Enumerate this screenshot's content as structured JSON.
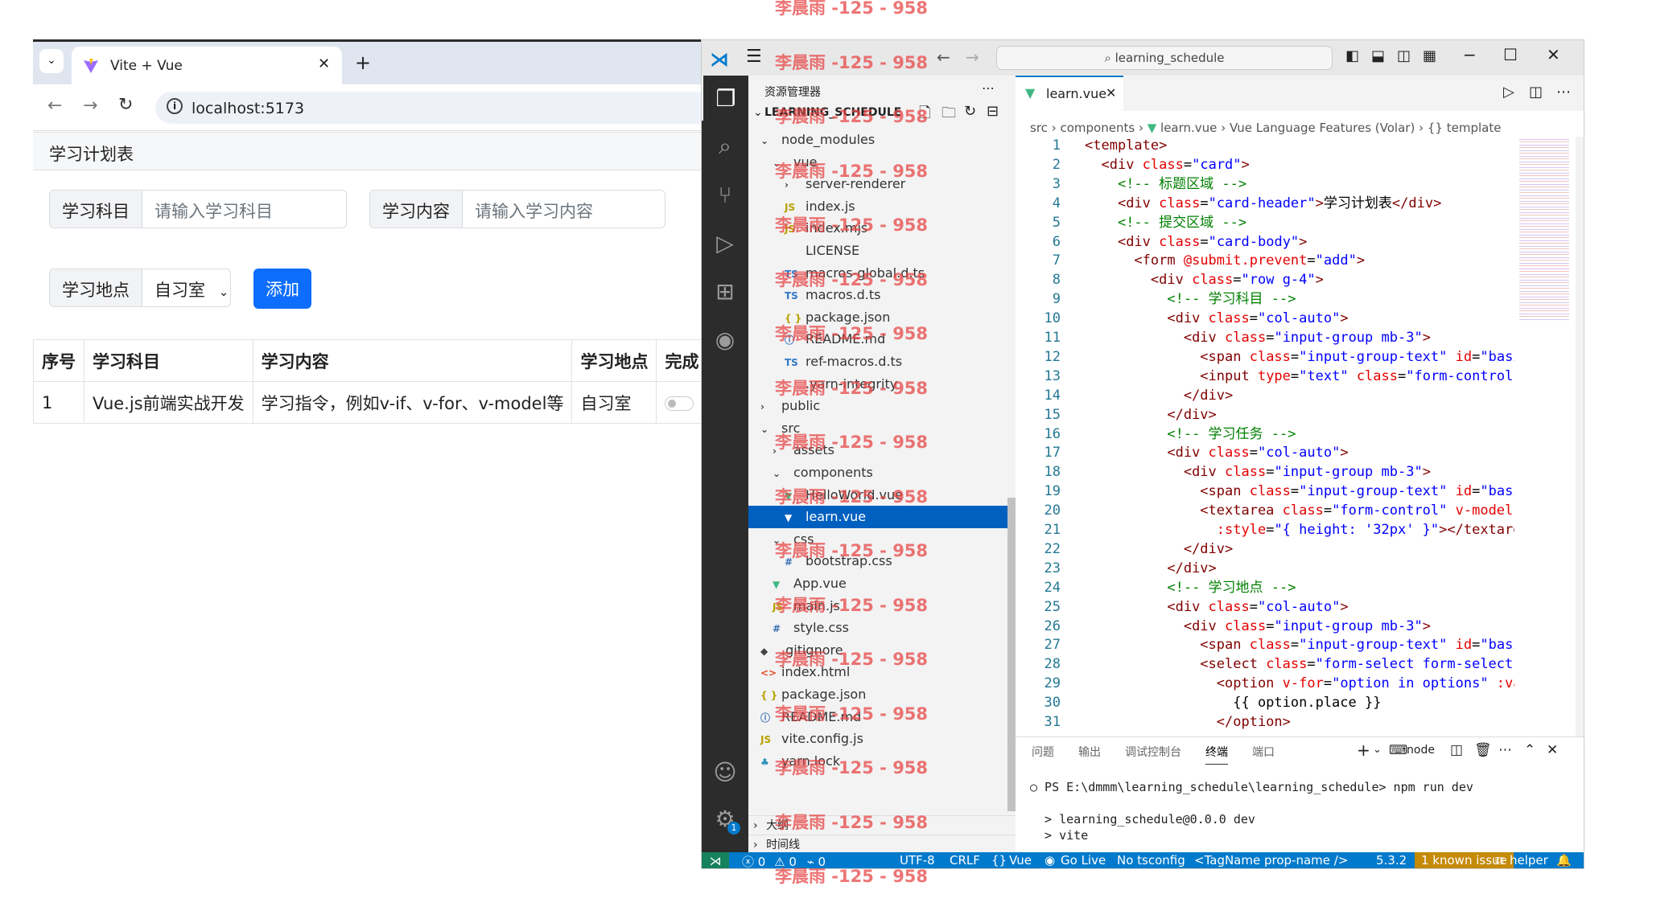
{
  "browser": {
    "tab_title": "Vite + Vue",
    "url": "localhost:5173",
    "page": {
      "header": "学习计划表",
      "subject_label": "学习科目",
      "subject_placeholder": "请输入学习科目",
      "content_label": "学习内容",
      "content_placeholder": "请输入学习内容",
      "place_label": "学习地点",
      "place_value": "自习室",
      "add_button": "添加",
      "table_headers": [
        "序号",
        "学习科目",
        "学习内容",
        "学习地点",
        "完成"
      ],
      "rows": [
        {
          "index": "1",
          "subject": "Vue.js前端实战开发",
          "content": "学习指令，例如v-if、v-for、v-model等",
          "place": "自习室",
          "done": false
        }
      ]
    }
  },
  "vscode": {
    "search_text": "learning_schedule",
    "explorer_title": "资源管理器",
    "project_title": "LEARNING_SCHEDULE",
    "tree": [
      {
        "label": "node_modules",
        "indent": 1,
        "icon": "chevron-down",
        "selected": false
      },
      {
        "label": "vue",
        "indent": 2,
        "icon": "chevron-down",
        "selected": false
      },
      {
        "label": "server-renderer",
        "indent": 3,
        "icon": "chevron-right",
        "selected": false
      },
      {
        "label": "index.js",
        "indent": 3,
        "icon": "js",
        "selected": false
      },
      {
        "label": "index.mjs",
        "indent": 3,
        "icon": "js",
        "selected": false
      },
      {
        "label": "LICENSE",
        "indent": 3,
        "icon": "none",
        "selected": false
      },
      {
        "label": "macros-global.d.ts",
        "indent": 3,
        "icon": "ts",
        "selected": false
      },
      {
        "label": "macros.d.ts",
        "indent": 3,
        "icon": "ts",
        "selected": false
      },
      {
        "label": "package.json",
        "indent": 3,
        "icon": "json",
        "selected": false
      },
      {
        "label": "README.md",
        "indent": 3,
        "icon": "info",
        "selected": false
      },
      {
        "label": "ref-macros.d.ts",
        "indent": 3,
        "icon": "ts",
        "selected": false
      },
      {
        "label": ".yarn-integrity",
        "indent": 3,
        "icon": "none",
        "selected": false
      },
      {
        "label": "public",
        "indent": 1,
        "icon": "chevron-right",
        "selected": false
      },
      {
        "label": "src",
        "indent": 1,
        "icon": "chevron-down",
        "selected": false
      },
      {
        "label": "assets",
        "indent": 2,
        "icon": "chevron-right",
        "selected": false
      },
      {
        "label": "components",
        "indent": 2,
        "icon": "chevron-down",
        "selected": false
      },
      {
        "label": "HelloWorld.vue",
        "indent": 3,
        "icon": "vue",
        "selected": false
      },
      {
        "label": "learn.vue",
        "indent": 3,
        "icon": "vue",
        "selected": true
      },
      {
        "label": "css",
        "indent": 2,
        "icon": "chevron-down",
        "selected": false
      },
      {
        "label": "bootstrap.css",
        "indent": 3,
        "icon": "hash",
        "selected": false
      },
      {
        "label": "App.vue",
        "indent": 2,
        "icon": "vue",
        "selected": false
      },
      {
        "label": "main.js",
        "indent": 2,
        "icon": "js",
        "selected": false
      },
      {
        "label": "style.css",
        "indent": 2,
        "icon": "hash",
        "selected": false
      },
      {
        "label": ".gitignore",
        "indent": 1,
        "icon": "diamond",
        "selected": false
      },
      {
        "label": "index.html",
        "indent": 1,
        "icon": "html",
        "selected": false
      },
      {
        "label": "package.json",
        "indent": 1,
        "icon": "json",
        "selected": false
      },
      {
        "label": "README.md",
        "indent": 1,
        "icon": "info",
        "selected": false
      },
      {
        "label": "vite.config.js",
        "indent": 1,
        "icon": "js",
        "selected": false
      },
      {
        "label": "yarn.lock",
        "indent": 1,
        "icon": "yarn",
        "selected": false
      }
    ],
    "outline_label": "大纲",
    "timeline_label": "时间线",
    "editor_tab": "learn.vue",
    "breadcrumb": [
      "src",
      "components",
      "learn.vue",
      "Vue Language Features (Volar)",
      "template"
    ],
    "code_lines": [
      [
        [
          "tg",
          "<template>"
        ]
      ],
      [
        [
          "tx",
          "  "
        ],
        [
          "tg",
          "<div "
        ],
        [
          "at",
          "class"
        ],
        [
          "tx",
          "="
        ],
        [
          "st",
          "\"card\""
        ],
        [
          "tg",
          ">"
        ]
      ],
      [
        [
          "tx",
          "    "
        ],
        [
          "cm",
          "<!-- 标题区域 -->"
        ]
      ],
      [
        [
          "tx",
          "    "
        ],
        [
          "tg",
          "<div "
        ],
        [
          "at",
          "class"
        ],
        [
          "tx",
          "="
        ],
        [
          "st",
          "\"card-header\""
        ],
        [
          "tg",
          ">"
        ],
        [
          "tx",
          "学习计划表"
        ],
        [
          "tg",
          "</div>"
        ]
      ],
      [
        [
          "tx",
          "    "
        ],
        [
          "cm",
          "<!-- 提交区域 -->"
        ]
      ],
      [
        [
          "tx",
          "    "
        ],
        [
          "tg",
          "<div "
        ],
        [
          "at",
          "class"
        ],
        [
          "tx",
          "="
        ],
        [
          "st",
          "\"card-body\""
        ],
        [
          "tg",
          ">"
        ]
      ],
      [
        [
          "tx",
          "      "
        ],
        [
          "tg",
          "<form "
        ],
        [
          "at",
          "@submit.prevent"
        ],
        [
          "tx",
          "="
        ],
        [
          "st",
          "\"add\""
        ],
        [
          "tg",
          ">"
        ]
      ],
      [
        [
          "tx",
          "        "
        ],
        [
          "tg",
          "<div "
        ],
        [
          "at",
          "class"
        ],
        [
          "tx",
          "="
        ],
        [
          "st",
          "\"row g-4\""
        ],
        [
          "tg",
          ">"
        ]
      ],
      [
        [
          "tx",
          "          "
        ],
        [
          "cm",
          "<!-- 学习科目 -->"
        ]
      ],
      [
        [
          "tx",
          "          "
        ],
        [
          "tg",
          "<div "
        ],
        [
          "at",
          "class"
        ],
        [
          "tx",
          "="
        ],
        [
          "st",
          "\"col-auto\""
        ],
        [
          "tg",
          ">"
        ]
      ],
      [
        [
          "tx",
          "            "
        ],
        [
          "tg",
          "<div "
        ],
        [
          "at",
          "class"
        ],
        [
          "tx",
          "="
        ],
        [
          "st",
          "\"input-group mb-3\""
        ],
        [
          "tg",
          ">"
        ]
      ],
      [
        [
          "tx",
          "              "
        ],
        [
          "tg",
          "<span "
        ],
        [
          "at",
          "class"
        ],
        [
          "tx",
          "="
        ],
        [
          "st",
          "\"input-group-text\" "
        ],
        [
          "at",
          "id"
        ],
        [
          "tx",
          "="
        ],
        [
          "st",
          "\"basic"
        ]
      ],
      [
        [
          "tx",
          "              "
        ],
        [
          "tg",
          "<input "
        ],
        [
          "at",
          "type"
        ],
        [
          "tx",
          "="
        ],
        [
          "st",
          "\"text\" "
        ],
        [
          "at",
          "class"
        ],
        [
          "tx",
          "="
        ],
        [
          "st",
          "\"form-control\""
        ]
      ],
      [
        [
          "tx",
          "            "
        ],
        [
          "tg",
          "</div>"
        ]
      ],
      [
        [
          "tx",
          "          "
        ],
        [
          "tg",
          "</div>"
        ]
      ],
      [
        [
          "tx",
          "          "
        ],
        [
          "cm",
          "<!-- 学习任务 -->"
        ]
      ],
      [
        [
          "tx",
          "          "
        ],
        [
          "tg",
          "<div "
        ],
        [
          "at",
          "class"
        ],
        [
          "tx",
          "="
        ],
        [
          "st",
          "\"col-auto\""
        ],
        [
          "tg",
          ">"
        ]
      ],
      [
        [
          "tx",
          "            "
        ],
        [
          "tg",
          "<div "
        ],
        [
          "at",
          "class"
        ],
        [
          "tx",
          "="
        ],
        [
          "st",
          "\"input-group mb-3\""
        ],
        [
          "tg",
          ">"
        ]
      ],
      [
        [
          "tx",
          "              "
        ],
        [
          "tg",
          "<span "
        ],
        [
          "at",
          "class"
        ],
        [
          "tx",
          "="
        ],
        [
          "st",
          "\"input-group-text\" "
        ],
        [
          "at",
          "id"
        ],
        [
          "tx",
          "="
        ],
        [
          "st",
          "\"basic"
        ]
      ],
      [
        [
          "tx",
          "              "
        ],
        [
          "tg",
          "<textarea "
        ],
        [
          "at",
          "class"
        ],
        [
          "tx",
          "="
        ],
        [
          "st",
          "\"form-control\" "
        ],
        [
          "at",
          "v-model.t"
        ]
      ],
      [
        [
          "tx",
          "                "
        ],
        [
          "at",
          ":style"
        ],
        [
          "tx",
          "="
        ],
        [
          "st",
          "\"{ height: '32px' }\""
        ],
        [
          "tg",
          "></textarea"
        ]
      ],
      [
        [
          "tx",
          "            "
        ],
        [
          "tg",
          "</div>"
        ]
      ],
      [
        [
          "tx",
          "          "
        ],
        [
          "tg",
          "</div>"
        ]
      ],
      [
        [
          "tx",
          "          "
        ],
        [
          "cm",
          "<!-- 学习地点 -->"
        ]
      ],
      [
        [
          "tx",
          "          "
        ],
        [
          "tg",
          "<div "
        ],
        [
          "at",
          "class"
        ],
        [
          "tx",
          "="
        ],
        [
          "st",
          "\"col-auto\""
        ],
        [
          "tg",
          ">"
        ]
      ],
      [
        [
          "tx",
          "            "
        ],
        [
          "tg",
          "<div "
        ],
        [
          "at",
          "class"
        ],
        [
          "tx",
          "="
        ],
        [
          "st",
          "\"input-group mb-3\""
        ],
        [
          "tg",
          ">"
        ]
      ],
      [
        [
          "tx",
          "              "
        ],
        [
          "tg",
          "<span "
        ],
        [
          "at",
          "class"
        ],
        [
          "tx",
          "="
        ],
        [
          "st",
          "\"input-group-text\" "
        ],
        [
          "at",
          "id"
        ],
        [
          "tx",
          "="
        ],
        [
          "st",
          "\"basic"
        ]
      ],
      [
        [
          "tx",
          "              "
        ],
        [
          "tg",
          "<select "
        ],
        [
          "at",
          "class"
        ],
        [
          "tx",
          "="
        ],
        [
          "st",
          "\"form-select form-select-s"
        ]
      ],
      [
        [
          "tx",
          "                "
        ],
        [
          "tg",
          "<option "
        ],
        [
          "at",
          "v-for"
        ],
        [
          "tx",
          "="
        ],
        [
          "st",
          "\"option in options\" "
        ],
        [
          "at",
          ":val"
        ]
      ],
      [
        [
          "tx",
          "                  "
        ],
        [
          "tx",
          "{{ option.place }}"
        ]
      ],
      [
        [
          "tx",
          "                "
        ],
        [
          "tg",
          "</option>"
        ]
      ]
    ],
    "panel_tabs": [
      "问题",
      "输出",
      "调试控制台",
      "终端",
      "端口"
    ],
    "panel_active": "终端",
    "terminal_shell": "node",
    "terminal_lines": [
      "PS E:\\dmmm\\learning_schedule\\learning_schedule> npm run dev",
      "",
      "> learning_schedule@0.0.0 dev",
      "> vite"
    ],
    "status": {
      "errors": "0",
      "warnings": "0",
      "ports": "0",
      "encoding": "UTF-8",
      "eol": "CRLF",
      "language": "Vue",
      "golive": "Go Live",
      "tsconfig": "No tsconfig",
      "tagname": "<TagName prop-name />",
      "version": "5.3.2",
      "issue": "1 known issue",
      "helper": "helper"
    },
    "accounts_badge": "1"
  },
  "watermark": "李晨雨 -125 - 958"
}
